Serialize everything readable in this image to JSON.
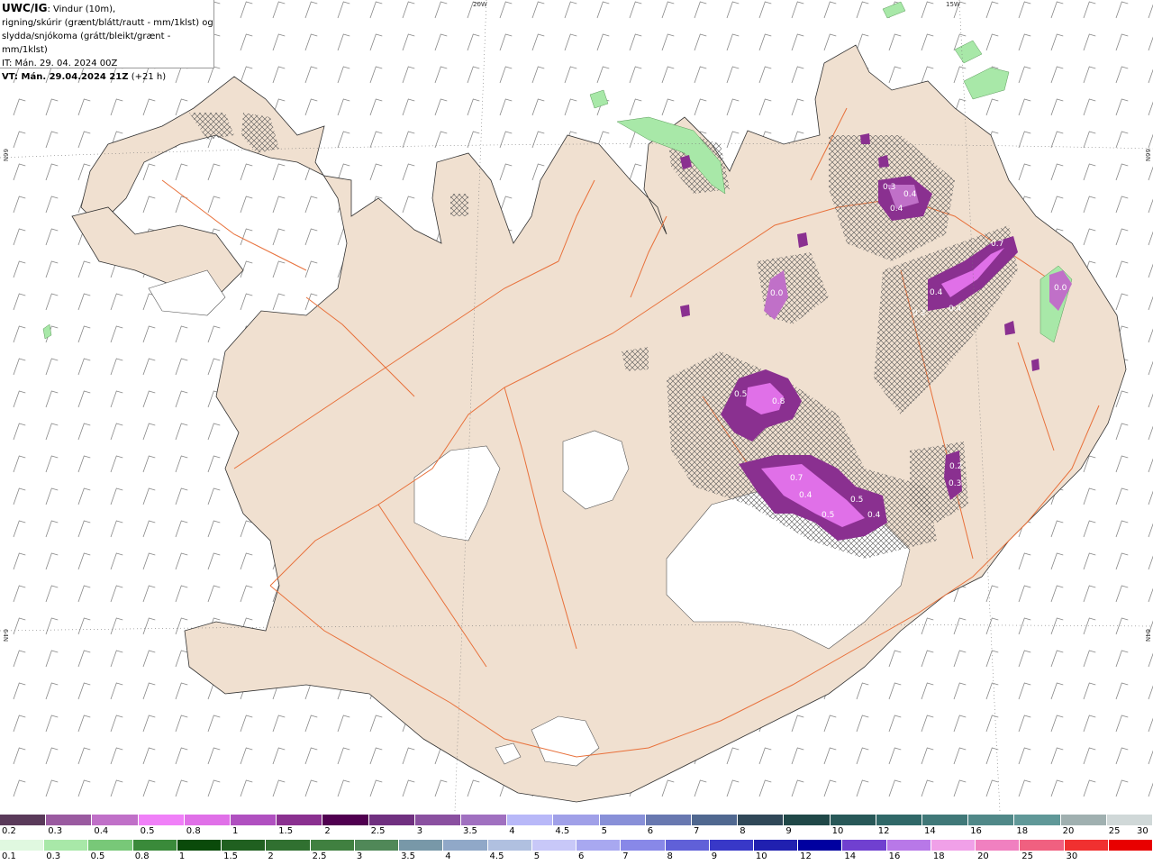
{
  "header": {
    "model_code": "UWC/IG",
    "desc_line1": ": Vindur (10m),",
    "desc_line2": "rigning/skúrir (grænt/blátt/rautt - mm/1klst) og",
    "desc_line3": "slydda/snjókoma (grátt/bleikt/grænt - mm/1klst)",
    "it_line": "IT: Mán. 29. 04. 2024 00Z",
    "vt_bold": "VT: Mán. 29.04.2024 21Z",
    "vt_suffix": " (+21 h)"
  },
  "grid_labels": {
    "lon_20w": "20W",
    "lon_15w": "15W",
    "lat_66n_left": "66N",
    "lat_66n_right": "66N",
    "lat_64n_left": "64N",
    "lat_64n_right": "64N"
  },
  "precip_values": [
    "0.3",
    "0.4",
    "0.4",
    "0.4",
    "0.4",
    "0.3",
    "0.7",
    "0.0",
    "0.5",
    "0.8",
    "0.7",
    "0.5",
    "0.5",
    "0.4",
    "0.4",
    "0.3",
    "0.2",
    "0.0"
  ],
  "colors": {
    "land": "#f0e0d0",
    "roads": "#e8703a",
    "snow_purple": "#b050c0",
    "snow_pink": "#e070e8",
    "rain_green": "#a8e8a8",
    "glacier": "#ffffff"
  },
  "snow_scale": {
    "labels": [
      "0.2",
      "0.3",
      "0.4",
      "0.5",
      "0.8",
      "1",
      "1.5",
      "2",
      "2.5",
      "3",
      "3.5",
      "4",
      "4.5",
      "5",
      "6",
      "7",
      "8",
      "9",
      "10",
      "12",
      "14",
      "16",
      "18",
      "20",
      "25",
      "30"
    ],
    "colors": [
      "#5a3a5a",
      "#9a5aa0",
      "#c070c8",
      "#f080f8",
      "#e070e8",
      "#b050c0",
      "#8a3090",
      "#500050",
      "#703080",
      "#8a50a0",
      "#a070c0",
      "#b8b8f8",
      "#a0a0e8",
      "#8890d8",
      "#6878b0",
      "#506890",
      "#304858",
      "#204848",
      "#285858",
      "#306868",
      "#407878",
      "#508888",
      "#609898",
      "#a0b0b0",
      "#d0d8d8"
    ]
  },
  "rain_scale": {
    "labels": [
      "0.1",
      "0.3",
      "0.5",
      "0.8",
      "1",
      "1.5",
      "2",
      "2.5",
      "3",
      "3.5",
      "4",
      "4.5",
      "5",
      "6",
      "7",
      "8",
      "9",
      "10",
      "12",
      "14",
      "16",
      "18",
      "20",
      "25",
      "30"
    ],
    "colors": [
      "#e0f8e0",
      "#a8e8a8",
      "#78c878",
      "#3a8a3a",
      "#0a4a0a",
      "#206020",
      "#307030",
      "#408040",
      "#508858",
      "#7898a8",
      "#90a8c8",
      "#b0c0e0",
      "#c8c8f8",
      "#a8a8f0",
      "#8888e8",
      "#6060d8",
      "#3838c8",
      "#2020b0",
      "#0000a0",
      "#7040d0",
      "#b878e8",
      "#f0a0e8",
      "#f080c0",
      "#f06080",
      "#f03030",
      "#e80000"
    ]
  }
}
